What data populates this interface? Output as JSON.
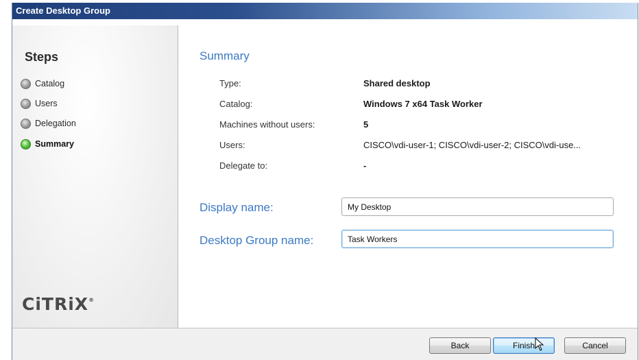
{
  "window": {
    "title": "Create Desktop Group"
  },
  "sidebar": {
    "title": "Steps",
    "steps": [
      {
        "label": "Catalog",
        "active": false
      },
      {
        "label": "Users",
        "active": false
      },
      {
        "label": "Delegation",
        "active": false
      },
      {
        "label": "Summary",
        "active": true
      }
    ],
    "logo": "CiTRiX",
    "logo_mark": "®"
  },
  "summary": {
    "title": "Summary",
    "rows": [
      {
        "key": "Type:",
        "value": "Shared desktop"
      },
      {
        "key": "Catalog:",
        "value": "Windows 7 x64 Task Worker"
      },
      {
        "key": "Machines without users:",
        "value": "5"
      },
      {
        "key": "Users:",
        "value": "CISCO\\vdi-user-1; CISCO\\vdi-user-2; CISCO\\vdi-use..."
      },
      {
        "key": "Delegate to:",
        "value": "-"
      }
    ]
  },
  "form": {
    "display_name_label": "Display name:",
    "display_name_value": "My Desktop",
    "group_name_label": "Desktop Group name:",
    "group_name_value": "Task Workers"
  },
  "footer": {
    "back_label": "Back",
    "finish_label": "Finish",
    "cancel_label": "Cancel"
  }
}
